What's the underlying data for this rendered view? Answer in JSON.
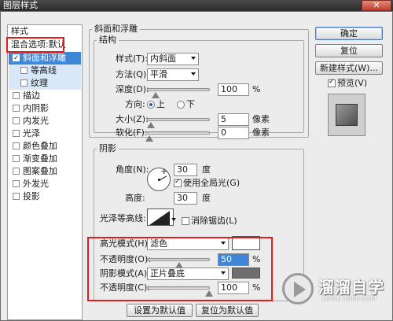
{
  "window": {
    "title": "图层样式",
    "close_label": "✕"
  },
  "style_list": {
    "header": "样式",
    "blend_default": "混合选项:默认",
    "items": [
      {
        "label": "斜面和浮雕",
        "checked": true,
        "active": true
      },
      {
        "label": "等高线",
        "checked": false,
        "sub": true
      },
      {
        "label": "纹理",
        "checked": false,
        "sub": true
      },
      {
        "label": "描边",
        "checked": false
      },
      {
        "label": "内阴影",
        "checked": false
      },
      {
        "label": "内发光",
        "checked": false
      },
      {
        "label": "光泽",
        "checked": false
      },
      {
        "label": "颜色叠加",
        "checked": false
      },
      {
        "label": "渐变叠加",
        "checked": false
      },
      {
        "label": "图案叠加",
        "checked": false
      },
      {
        "label": "外发光",
        "checked": false
      },
      {
        "label": "投影",
        "checked": false
      }
    ]
  },
  "bevel": {
    "section_title": "斜面和浮雕",
    "structure_title": "结构",
    "style_label": "样式(T):",
    "style_value": "内斜面",
    "technique_label": "方法(Q):",
    "technique_value": "平滑",
    "depth_label": "深度(D):",
    "depth_value": "100",
    "depth_unit": "%",
    "depth_level": 0.1,
    "direction_label": "方向:",
    "dir_up": "上",
    "dir_down": "下",
    "size_label": "大小(Z):",
    "size_value": "5",
    "size_unit": "像素",
    "size_level": 0.03,
    "soften_label": "软化(F):",
    "soften_value": "0",
    "soften_unit": "像素",
    "soften_level": 0.0
  },
  "shading": {
    "title": "阴影",
    "angle_label": "角度(N):",
    "angle_value": "30",
    "angle_unit": "度",
    "global_light_label": "使用全局光(G)",
    "altitude_label": "高度:",
    "altitude_value": "30",
    "altitude_unit": "度",
    "gloss_contour_label": "光泽等高线:",
    "anti_alias_label": "消除锯齿(L)",
    "highlight_mode_label": "高光模式(H):",
    "highlight_mode_value": "滤色",
    "highlight_opacity_label": "不透明度(O):",
    "highlight_opacity_value": "50",
    "highlight_opacity_unit": "%",
    "highlight_opacity_level": 0.5,
    "shadow_mode_label": "阴影模式(A):",
    "shadow_mode_value": "正片叠底",
    "shadow_opacity_label": "不透明度(C):",
    "shadow_opacity_value": "100",
    "shadow_opacity_unit": "%",
    "shadow_opacity_level": 1.0,
    "highlight_color": "#ffffff",
    "shadow_color": "#6e6e6e"
  },
  "actions": {
    "make_default": "设置为默认值",
    "reset_default": "复位为默认值",
    "ok": "确定",
    "reset": "复位",
    "new_style": "新建样式(W)...",
    "preview": "预览(V)"
  },
  "watermark": {
    "text": "溜溜自学",
    "sub": "ZIXUE.3D66.COM"
  },
  "colors": {
    "highlight_red": "#e01e1e",
    "selection_blue": "#3d86d8"
  }
}
